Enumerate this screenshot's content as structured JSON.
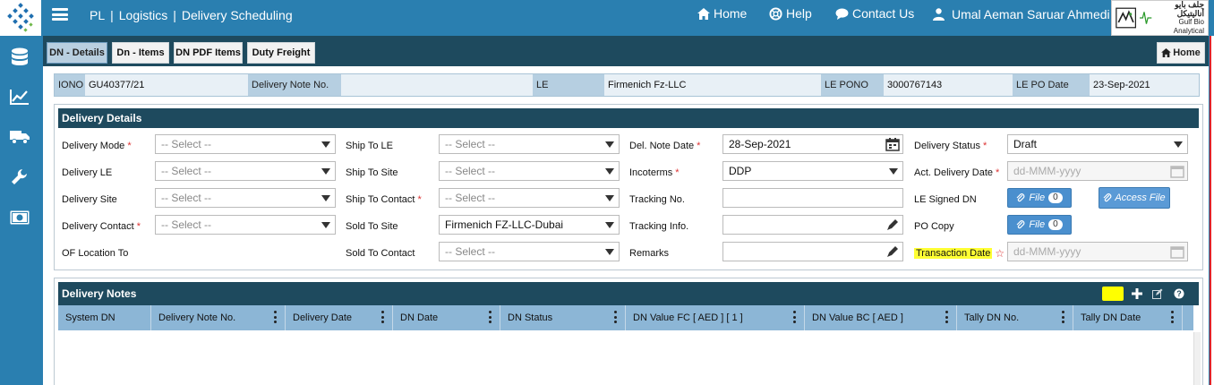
{
  "header": {
    "crumbs": [
      "PL",
      "Logistics",
      "Delivery Scheduling"
    ],
    "nav": [
      {
        "label": "Home",
        "icon": "home-icon"
      },
      {
        "label": "Help",
        "icon": "lifebuoy-icon"
      },
      {
        "label": "Contact Us",
        "icon": "chat-icon"
      }
    ],
    "user_name": "Umal Aeman Saruar Ahmedi",
    "brand_arabic": "جلف بايو أناليتيكل",
    "brand_english": "Gulf Bio Analytical"
  },
  "sidebar": {
    "icons": [
      "database-icon",
      "line-chart-icon",
      "truck-icon",
      "wrench-icon",
      "money-icon"
    ]
  },
  "tabs": [
    {
      "label": "DN - Details",
      "active": true
    },
    {
      "label": "Dn - Items",
      "active": false
    },
    {
      "label": "DN PDF Items",
      "active": false
    },
    {
      "label": "Duty Freight",
      "active": false
    }
  ],
  "home_button": "Home",
  "info": {
    "iono_label": "IONO",
    "iono_value": "GU40377/21",
    "dn_label": "Delivery Note No.",
    "dn_value": "",
    "le_label": "LE",
    "le_value": "Firmenich Fz-LLC",
    "lepono_label": "LE PONO",
    "lepono_value": "3000767143",
    "lepodate_label": "LE PO Date",
    "lepodate_value": "23-Sep-2021"
  },
  "details": {
    "title": "Delivery Details",
    "select_placeholder": "-- Select --",
    "date_placeholder": "dd-MMM-yyyy",
    "col1": {
      "delivery_mode": "Delivery Mode",
      "delivery_le": "Delivery LE",
      "delivery_site": "Delivery Site",
      "delivery_contact": "Delivery Contact",
      "of_location_to": "OF Location To"
    },
    "col2": {
      "ship_to_le": "Ship To LE",
      "ship_to_site": "Ship To Site",
      "ship_to_contact": "Ship To Contact",
      "sold_to_site": "Sold To Site",
      "sold_to_site_value": "Firmenich FZ-LLC-Dubai",
      "sold_to_contact": "Sold To Contact"
    },
    "col3": {
      "del_note_date": "Del. Note Date",
      "del_note_date_value": "28-Sep-2021",
      "incoterms": "Incoterms",
      "incoterms_value": "DDP",
      "tracking_no": "Tracking No.",
      "tracking_info": "Tracking Info.",
      "remarks": "Remarks"
    },
    "col4": {
      "delivery_status": "Delivery Status",
      "delivery_status_value": "Draft",
      "act_delivery_date": "Act. Delivery Date",
      "le_signed_dn": "LE Signed DN",
      "po_copy": "PO Copy",
      "transaction_date": "Transaction Date"
    },
    "file_label": "File",
    "file_count_signed": "0",
    "file_count_po": "0",
    "access_file": "Access File"
  },
  "notes": {
    "title": "Delivery Notes",
    "columns": [
      "System DN",
      "Delivery Note No.",
      "Delivery Date",
      "DN Date",
      "DN Status",
      "DN Value FC [ AED ] [ 1 ]",
      "DN Value BC [ AED ]",
      "Tally DN No.",
      "Tally DN Date"
    ]
  },
  "colors": {
    "header_blue": "#2a7fb0",
    "panel_dark": "#1e4a5e",
    "grid_head": "#8cb6d6",
    "file_button": "#4a8fce",
    "required": "#dd3333",
    "highlight": "#ffff33"
  }
}
